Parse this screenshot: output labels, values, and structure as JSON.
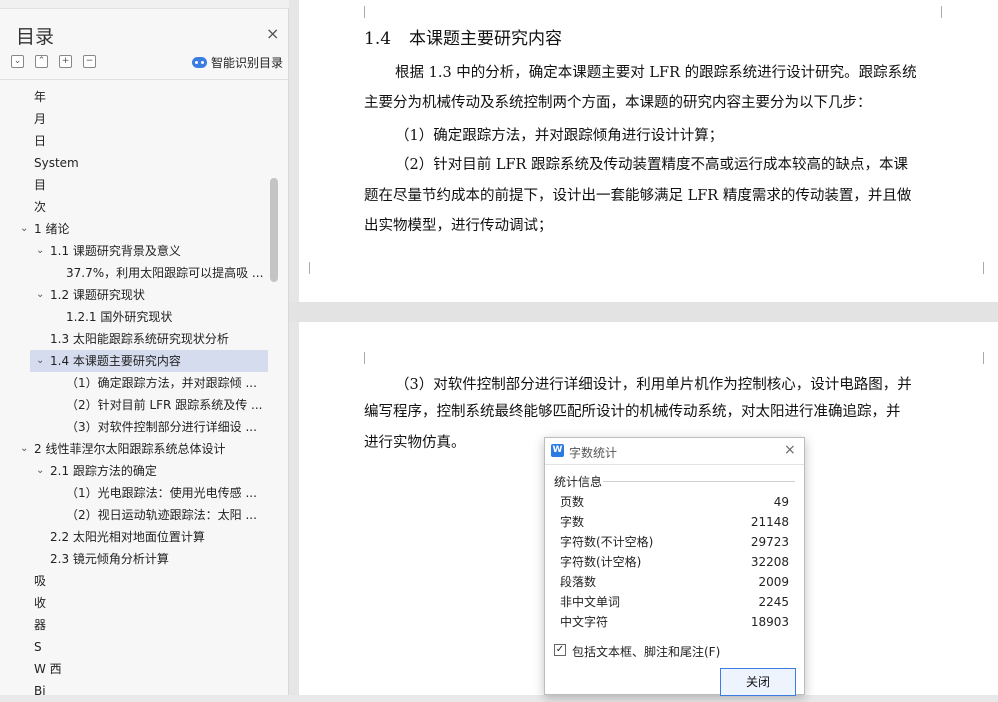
{
  "toc": {
    "title": "目录",
    "close_symbol": "×",
    "toolbar": [
      "⌄",
      "⌃",
      "+",
      "−"
    ],
    "smart_label": "智能识别目录",
    "items": [
      {
        "label": "年",
        "level": 0,
        "chev": ""
      },
      {
        "label": "月",
        "level": 0,
        "chev": ""
      },
      {
        "label": "日",
        "level": 0,
        "chev": ""
      },
      {
        "label": "System",
        "level": 0,
        "chev": ""
      },
      {
        "label": "目",
        "level": 0,
        "chev": ""
      },
      {
        "label": "次",
        "level": 0,
        "chev": ""
      },
      {
        "label": "1  绪论",
        "level": 0,
        "chev": "⌄"
      },
      {
        "label": "1.1  课题研究背景及意义",
        "level": 1,
        "chev": "⌄"
      },
      {
        "label": "37.7%，利用太阳跟踪可以提高吸 ...",
        "level": 2,
        "chev": ""
      },
      {
        "label": "1.2  课题研究现状",
        "level": 1,
        "chev": "⌄"
      },
      {
        "label": "1.2.1  国外研究现状",
        "level": 2,
        "chev": ""
      },
      {
        "label": "1.3  太阳能跟踪系统研究现状分析",
        "level": 1,
        "chev": ""
      },
      {
        "label": "1.4  本课题主要研究内容",
        "level": 1,
        "chev": "⌄",
        "selected": true
      },
      {
        "label": "（1）确定跟踪方法，并对跟踪倾 ...",
        "level": 2,
        "chev": ""
      },
      {
        "label": "（2）针对目前 LFR 跟踪系统及传 ...",
        "level": 2,
        "chev": ""
      },
      {
        "label": "（3）对软件控制部分进行详细设 ...",
        "level": 2,
        "chev": ""
      },
      {
        "label": "2  线性菲涅尔太阳跟踪系统总体设计",
        "level": 0,
        "chev": "⌄"
      },
      {
        "label": "2.1  跟踪方法的确定",
        "level": 1,
        "chev": "⌄"
      },
      {
        "label": "（1）光电跟踪法：使用光电传感 ...",
        "level": 2,
        "chev": ""
      },
      {
        "label": "（2）视日运动轨迹跟踪法：太阳 ...",
        "level": 2,
        "chev": ""
      },
      {
        "label": "2.2  太阳光相对地面位置计算",
        "level": 1,
        "chev": ""
      },
      {
        "label": "2.3  镜元倾角分析计算",
        "level": 1,
        "chev": ""
      },
      {
        "label": "吸",
        "level": 0,
        "chev": ""
      },
      {
        "label": "收",
        "level": 0,
        "chev": ""
      },
      {
        "label": "器",
        "level": 0,
        "chev": ""
      },
      {
        "label": "S",
        "level": 0,
        "chev": ""
      },
      {
        "label": "W 西",
        "level": 0,
        "chev": ""
      },
      {
        "label": "Bi",
        "level": 0,
        "chev": ""
      }
    ]
  },
  "doc": {
    "heading_num": "1.4",
    "heading_text": "本课题主要研究内容",
    "p1_line1": "根据 1.3 中的分析，确定本课题主要对 LFR 的跟踪系统进行设计研究。跟踪系统",
    "p1_line2": "主要分为机械传动及系统控制两个方面，本课题的研究内容主要分为以下几步：",
    "p2": "（1）确定跟踪方法，并对跟踪倾角进行设计计算；",
    "p3_line1": "（2）针对目前 LFR 跟踪系统及传动装置精度不高或运行成本较高的缺点，本课",
    "p3_line2": "题在尽量节约成本的前提下，设计出一套能够满足 LFR 精度需求的传动装置，并且做",
    "p3_line3": "出实物模型，进行传动调试；",
    "p4_line1": "（3）对软件控制部分进行详细设计，利用单片机作为控制核心，设计电路图，并",
    "p4_line2": "编写程序，控制系统最终能够匹配所设计的机械传动系统，对太阳进行准确追踪，并",
    "p4_line3": "进行实物仿真。"
  },
  "dialog": {
    "title": "字数统计",
    "close_symbol": "×",
    "group_label": "统计信息",
    "stats": [
      {
        "k": "页数",
        "v": "49"
      },
      {
        "k": "字数",
        "v": "21148"
      },
      {
        "k": "字符数(不计空格)",
        "v": "29723"
      },
      {
        "k": "字符数(计空格)",
        "v": "32208"
      },
      {
        "k": "段落数",
        "v": "2009"
      },
      {
        "k": "非中文单词",
        "v": "2245"
      },
      {
        "k": "中文字符",
        "v": "18903"
      }
    ],
    "checkbox_label": "包括文本框、脚注和尾注(F)",
    "checkbox_checked": true,
    "close_button": "关闭"
  }
}
